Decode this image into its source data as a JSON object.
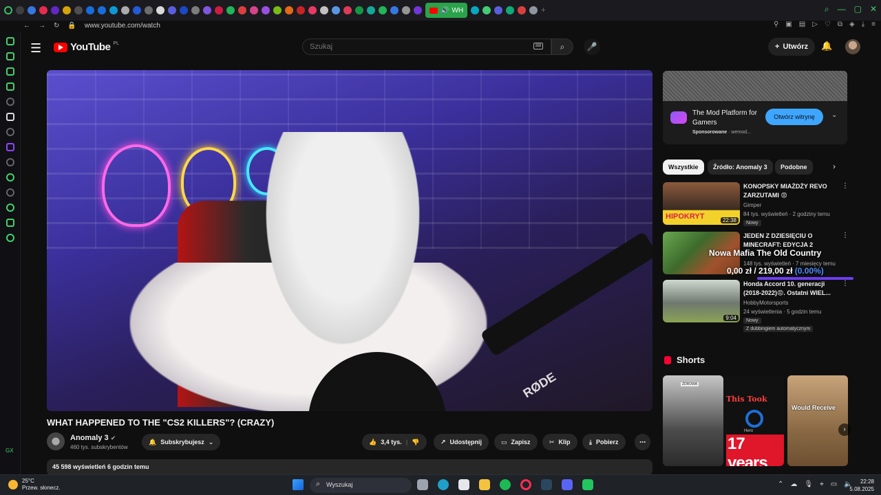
{
  "browser": {
    "url": "www.youtube.com/watch",
    "active_tab_label": "WH"
  },
  "sidebar": {
    "gx_label": "GX"
  },
  "header": {
    "logo_text": "YouTube",
    "logo_region": "PL",
    "search_placeholder": "Szukaj",
    "create_label": "Utwórz"
  },
  "video": {
    "title": "WHAT HAPPENED TO THE \"CS2 KILLERS\"? (CRAZY)",
    "overlay_brand": "RØDE",
    "channel_name": "Anomaly 3",
    "channel_subs": "460 tys. subskrybentów",
    "subscribe_label": "Subskrybujesz",
    "like_count": "3,4 tys.",
    "share_label": "Udostępnij",
    "save_label": "Zapisz",
    "clip_label": "Klip",
    "download_label": "Pobierz",
    "views_line": "45 598 wyświetleń  6 godzin temu"
  },
  "ad": {
    "title": "The Mod Platform for Gamers",
    "sponsored": "Sponsorowane",
    "domain": "wemod...",
    "cta": "Otwórz witrynę"
  },
  "chips": [
    "Wszystkie",
    "Źródło: Anomaly 3",
    "Podobne"
  ],
  "recommendations": [
    {
      "title": "KONOPSKY MIAŻDŻY REVO ZARZUTAMI 😡",
      "channel": "Gimper",
      "meta": "84 tys. wyświetleń · 2 godziny temu",
      "badge": "Nowy",
      "duration": "22:38",
      "thumb_text": "HIPOKRYT"
    },
    {
      "title": "JEDEN Z DZIESIĘCIU O MINECRAFT: EDYCJA 2",
      "channel": "",
      "meta": "148 tys. wyświetleń · 7 miesięcy temu",
      "badge": "",
      "duration": ""
    },
    {
      "title": "Honda Accord 10. generacji (2018-2022)😡. Ostatni WIEL...",
      "channel": "HobbyMotorsports",
      "meta": "24 wyświetlenia · 5 godzin temu",
      "badge": "Nowy",
      "badge2": "Z dubbingiem automatycznym",
      "duration": "9:04"
    }
  ],
  "price_overlay": {
    "title": "Nowa Mafia The Old Country",
    "price": "0,00 zł / 219,00 zł",
    "percent": "(0.00%)"
  },
  "shorts": {
    "heading": "Shorts",
    "s1_label": "ZDROWA",
    "s2_top": "This Took",
    "s2_small": "Hero",
    "s2_big": "17 years",
    "s3_text": "Would Receive"
  },
  "taskbar": {
    "temp": "25°C",
    "weather": "Przew. słonecz.",
    "search": "Wyszukaj",
    "time": "22:28",
    "date": "5.08.2025"
  }
}
